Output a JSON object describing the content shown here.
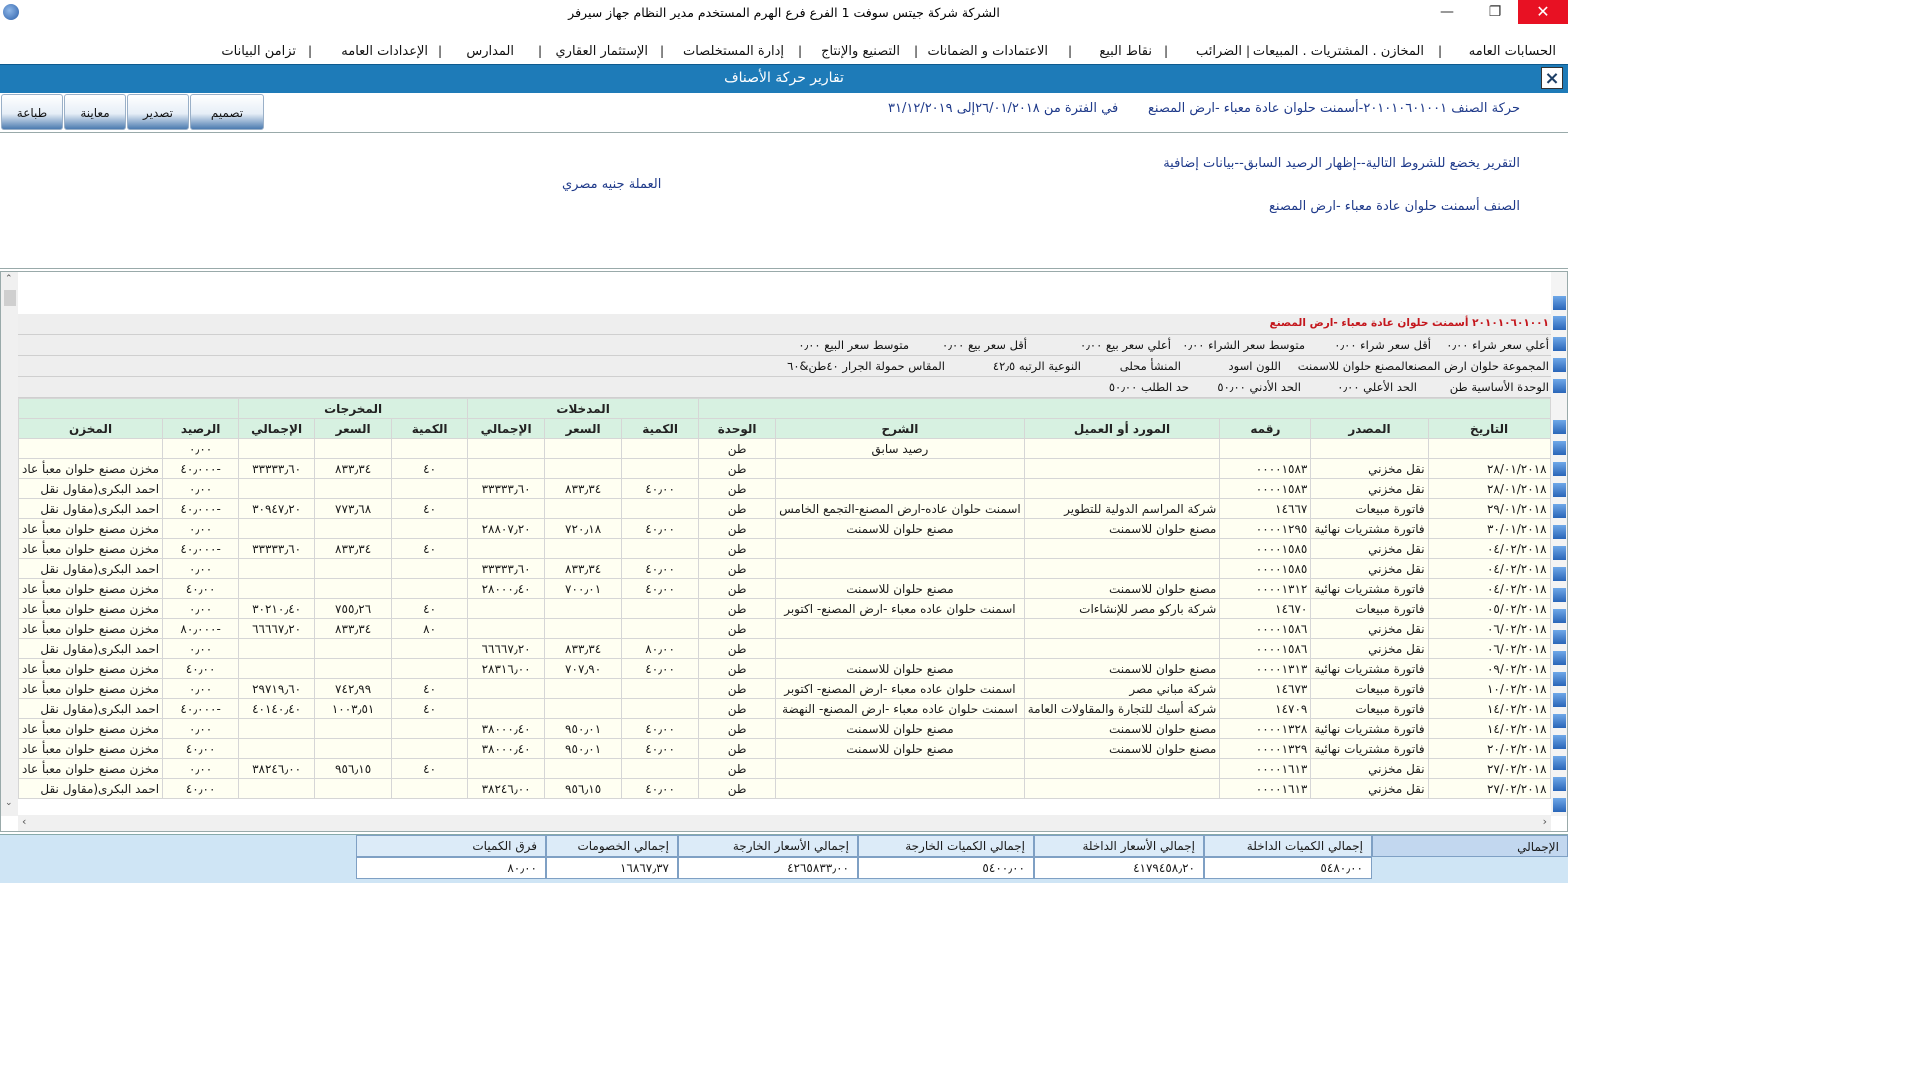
{
  "window": {
    "title": "الشركة شركة جيتس سوفت 1   الفرع فرع الهرم   المستخدم مدير النظام  جهاز سيرفر",
    "minimize_icon": "minimize-icon",
    "maximize_icon": "restore-icon",
    "close_icon": "close-icon"
  },
  "menu": [
    {
      "label": "الحسابات العامه"
    },
    {
      "label": "المخازن . المشتريات . المبيعات"
    },
    {
      "label": "الضرائب"
    },
    {
      "label": "نقاط البيع"
    },
    {
      "label": "الاعتمادات و الضمانات"
    },
    {
      "label": "التصنيع والإنتاج"
    },
    {
      "label": "إدارة المستخلصات"
    },
    {
      "label": "الإستثمار العقاري"
    },
    {
      "label": "المدارس"
    },
    {
      "label": "الإعدادات العامه"
    },
    {
      "label": "تزامن البيانات"
    }
  ],
  "header": {
    "title": "تقارير حركة الأصناف",
    "close": "×"
  },
  "toolbar": {
    "design": "تصميم",
    "export": "تصدير",
    "preview": "معاينة",
    "print": "طباعة"
  },
  "report": {
    "item_title": "حركة الصنف ٢٠١٠١٠٦٠١٠٠١-أسمنت حلوان عادة معباء -ارض المصنع",
    "period": "في الفترة من ٢٦/٠١/٢٠١٨إلى ٣١/١٢/٢٠١٩",
    "conditions": "التقرير يخضع للشروط التالية--إظهار الرصيد السابق--بيانات إضافية",
    "currency": "العملة جنيه مصري",
    "item_line": "الصنف أسمنت حلوان عادة معباء -ارض المصنع"
  },
  "grid_info": {
    "item_code_name": "٢٠١٠١٠٦٠١٠٠١ أسمنت حلوان عادة معباء -ارض المصنع",
    "max_buy": "أعلي سعر شراء ٠٫٠٠",
    "min_buy": "أقل سعر شراء ٠٫٠٠",
    "avg_buy": "متوسط سعر الشراء ٠٫٠٠",
    "max_sell": "أعلي سعر بيع ٠٫٠٠",
    "min_sell": "أقل سعر بيع ٠٫٠٠",
    "avg_sell": "متوسط سعر البيع ٠٫٠٠",
    "group": "المجموعة حلوان ارض المصنعالمصنع حلوان للاسمنت",
    "color": "اللون اسود",
    "origin": "المنشأ محلى",
    "grade": "النوعية الرتبه ٤٢٫٥",
    "size": "المقاس حمولة الجرار ٤٠طن&٦٠",
    "base_unit": "الوحدة الأساسية طن",
    "max_limit": "الحد الأعلي ٠٫٠٠",
    "min_limit": "الحد الأدني ٥٠٫٠٠",
    "reorder": "حد الطلب ٥٠٫٠٠"
  },
  "table": {
    "group_in": "المدخلات",
    "group_out": "المخرجات",
    "columns": {
      "date": "التاريخ",
      "source": "المصدر",
      "number": "رقمه",
      "party": "المورد أو العميل",
      "desc": "الشرح",
      "unit": "الوحدة",
      "in_qty": "الكمية",
      "in_price": "السعر",
      "in_total": "الإجمالي",
      "out_qty": "الكمية",
      "out_price": "السعر",
      "out_total": "الإجمالي",
      "balance": "الرصيد",
      "store": "المخزن"
    },
    "rows": [
      {
        "date": "",
        "source": "",
        "number": "",
        "party": "",
        "desc": "رصيد سابق",
        "unit": "طن",
        "in_qty": "",
        "in_price": "",
        "in_total": "",
        "out_qty": "",
        "out_price": "",
        "out_total": "",
        "balance": "٠٫٠٠",
        "store": ""
      },
      {
        "date": "٢٨/٠١/٢٠١٨",
        "source": "نقل مخزني",
        "number": "٠٠٠٠١٥٨٣",
        "party": "",
        "desc": "",
        "unit": "طن",
        "in_qty": "",
        "in_price": "",
        "in_total": "",
        "out_qty": "٤٠",
        "out_price": "٨٣٣٫٣٤",
        "out_total": "٣٣٣٣٣٫٦٠",
        "balance": "-٤٠٫٠٠٠",
        "store": "مخزن مصنع حلوان معبأ عاد"
      },
      {
        "date": "٢٨/٠١/٢٠١٨",
        "source": "نقل مخزني",
        "number": "٠٠٠٠١٥٨٣",
        "party": "",
        "desc": "",
        "unit": "طن",
        "in_qty": "٤٠٫٠٠",
        "in_price": "٨٣٣٫٣٤",
        "in_total": "٣٣٣٣٣٫٦٠",
        "out_qty": "",
        "out_price": "",
        "out_total": "",
        "balance": "٠٫٠٠",
        "store": "احمد البكرى(مقاول نقل"
      },
      {
        "date": "٢٩/٠١/٢٠١٨",
        "source": "فاتورة مبيعات",
        "number": "١٤٦٦٧",
        "party": "شركة المراسم الدولية للتطوير",
        "desc": "اسمنت حلوان عاده-ارض المصنع-التجمع الخامس",
        "unit": "طن",
        "in_qty": "",
        "in_price": "",
        "in_total": "",
        "out_qty": "٤٠",
        "out_price": "٧٧٣٫٦٨",
        "out_total": "٣٠٩٤٧٫٢٠",
        "balance": "-٤٠٫٠٠٠",
        "store": "احمد البكرى(مقاول نقل"
      },
      {
        "date": "٣٠/٠١/٢٠١٨",
        "source": "فاتورة مشتريات نهائية",
        "number": "٠٠٠٠١٢٩٥",
        "party": "مصنع حلوان للاسمنت",
        "desc": "مصنع حلوان للاسمنت",
        "unit": "طن",
        "in_qty": "٤٠٫٠٠",
        "in_price": "٧٢٠٫١٨",
        "in_total": "٢٨٨٠٧٫٢٠",
        "out_qty": "",
        "out_price": "",
        "out_total": "",
        "balance": "٠٫٠٠",
        "store": "مخزن مصنع حلوان معبأ عاد"
      },
      {
        "date": "٠٤/٠٢/٢٠١٨",
        "source": "نقل مخزني",
        "number": "٠٠٠٠١٥٨٥",
        "party": "",
        "desc": "",
        "unit": "طن",
        "in_qty": "",
        "in_price": "",
        "in_total": "",
        "out_qty": "٤٠",
        "out_price": "٨٣٣٫٣٤",
        "out_total": "٣٣٣٣٣٫٦٠",
        "balance": "-٤٠٫٠٠٠",
        "store": "مخزن مصنع حلوان معبأ عاد"
      },
      {
        "date": "٠٤/٠٢/٢٠١٨",
        "source": "نقل مخزني",
        "number": "٠٠٠٠١٥٨٥",
        "party": "",
        "desc": "",
        "unit": "طن",
        "in_qty": "٤٠٫٠٠",
        "in_price": "٨٣٣٫٣٤",
        "in_total": "٣٣٣٣٣٫٦٠",
        "out_qty": "",
        "out_price": "",
        "out_total": "",
        "balance": "٠٫٠٠",
        "store": "احمد البكرى(مقاول نقل"
      },
      {
        "date": "٠٤/٠٢/٢٠١٨",
        "source": "فاتورة مشتريات نهائية",
        "number": "٠٠٠٠١٣١٢",
        "party": "مصنع حلوان للاسمنت",
        "desc": "مصنع حلوان للاسمنت",
        "unit": "طن",
        "in_qty": "٤٠٫٠٠",
        "in_price": "٧٠٠٫٠١",
        "in_total": "٢٨٠٠٠٫٤٠",
        "out_qty": "",
        "out_price": "",
        "out_total": "",
        "balance": "٤٠٫٠٠",
        "store": "مخزن مصنع حلوان معبأ عاد"
      },
      {
        "date": "٠٥/٠٢/٢٠١٨",
        "source": "فاتورة مبيعات",
        "number": "١٤٦٧٠",
        "party": "شركة باركو مصر للإنشاءات",
        "desc": "اسمنت حلوان عاده معباء -ارض المصنع- اكتوبر",
        "unit": "طن",
        "in_qty": "",
        "in_price": "",
        "in_total": "",
        "out_qty": "٤٠",
        "out_price": "٧٥٥٫٢٦",
        "out_total": "٣٠٢١٠٫٤٠",
        "balance": "٠٫٠٠",
        "store": "مخزن مصنع حلوان معبأ عاد"
      },
      {
        "date": "٠٦/٠٢/٢٠١٨",
        "source": "نقل مخزني",
        "number": "٠٠٠٠١٥٨٦",
        "party": "",
        "desc": "",
        "unit": "طن",
        "in_qty": "",
        "in_price": "",
        "in_total": "",
        "out_qty": "٨٠",
        "out_price": "٨٣٣٫٣٤",
        "out_total": "٦٦٦٦٧٫٢٠",
        "balance": "-٨٠٫٠٠٠",
        "store": "مخزن مصنع حلوان معبأ عاد"
      },
      {
        "date": "٠٦/٠٢/٢٠١٨",
        "source": "نقل مخزني",
        "number": "٠٠٠٠١٥٨٦",
        "party": "",
        "desc": "",
        "unit": "طن",
        "in_qty": "٨٠٫٠٠",
        "in_price": "٨٣٣٫٣٤",
        "in_total": "٦٦٦٦٧٫٢٠",
        "out_qty": "",
        "out_price": "",
        "out_total": "",
        "balance": "٠٫٠٠",
        "store": "احمد البكرى(مقاول نقل"
      },
      {
        "date": "٠٩/٠٢/٢٠١٨",
        "source": "فاتورة مشتريات نهائية",
        "number": "٠٠٠٠١٣١٣",
        "party": "مصنع حلوان للاسمنت",
        "desc": "مصنع حلوان للاسمنت",
        "unit": "طن",
        "in_qty": "٤٠٫٠٠",
        "in_price": "٧٠٧٫٩٠",
        "in_total": "٢٨٣١٦٫٠٠",
        "out_qty": "",
        "out_price": "",
        "out_total": "",
        "balance": "٤٠٫٠٠",
        "store": "مخزن مصنع حلوان معبأ عاد"
      },
      {
        "date": "١٠/٠٢/٢٠١٨",
        "source": "فاتورة مبيعات",
        "number": "١٤٦٧٣",
        "party": "شركة مباني مصر",
        "desc": "اسمنت حلوان عاده معباء -ارض المصنع- اكتوبر",
        "unit": "طن",
        "in_qty": "",
        "in_price": "",
        "in_total": "",
        "out_qty": "٤٠",
        "out_price": "٧٤٢٫٩٩",
        "out_total": "٢٩٧١٩٫٦٠",
        "balance": "٠٫٠٠",
        "store": "مخزن مصنع حلوان معبأ عاد"
      },
      {
        "date": "١٤/٠٢/٢٠١٨",
        "source": "فاتورة مبيعات",
        "number": "١٤٧٠٩",
        "party": "شركة أسيك للتجارة والمقاولات العامة",
        "desc": "اسمنت حلوان عاده معباء -ارض المصنع- النهضة",
        "unit": "طن",
        "in_qty": "",
        "in_price": "",
        "in_total": "",
        "out_qty": "٤٠",
        "out_price": "١٠٠٣٫٥١",
        "out_total": "٤٠١٤٠٫٤٠",
        "balance": "-٤٠٫٠٠٠",
        "store": "احمد البكرى(مقاول نقل"
      },
      {
        "date": "١٤/٠٢/٢٠١٨",
        "source": "فاتورة مشتريات نهائية",
        "number": "٠٠٠٠١٣٢٨",
        "party": "مصنع حلوان للاسمنت",
        "desc": "مصنع حلوان للاسمنت",
        "unit": "طن",
        "in_qty": "٤٠٫٠٠",
        "in_price": "٩٥٠٫٠١",
        "in_total": "٣٨٠٠٠٫٤٠",
        "out_qty": "",
        "out_price": "",
        "out_total": "",
        "balance": "٠٫٠٠",
        "store": "مخزن مصنع حلوان معبأ عاد"
      },
      {
        "date": "٢٠/٠٢/٢٠١٨",
        "source": "فاتورة مشتريات نهائية",
        "number": "٠٠٠٠١٣٢٩",
        "party": "مصنع حلوان للاسمنت",
        "desc": "مصنع حلوان للاسمنت",
        "unit": "طن",
        "in_qty": "٤٠٫٠٠",
        "in_price": "٩٥٠٫٠١",
        "in_total": "٣٨٠٠٠٫٤٠",
        "out_qty": "",
        "out_price": "",
        "out_total": "",
        "balance": "٤٠٫٠٠",
        "store": "مخزن مصنع حلوان معبأ عاد"
      },
      {
        "date": "٢٧/٠٢/٢٠١٨",
        "source": "نقل مخزني",
        "number": "٠٠٠٠١٦١٣",
        "party": "",
        "desc": "",
        "unit": "طن",
        "in_qty": "",
        "in_price": "",
        "in_total": "",
        "out_qty": "٤٠",
        "out_price": "٩٥٦٫١٥",
        "out_total": "٣٨٢٤٦٫٠٠",
        "balance": "٠٫٠٠",
        "store": "مخزن مصنع حلوان معبأ عاد"
      },
      {
        "date": "٢٧/٠٢/٢٠١٨",
        "source": "نقل مخزني",
        "number": "٠٠٠٠١٦١٣",
        "party": "",
        "desc": "",
        "unit": "طن",
        "in_qty": "٤٠٫٠٠",
        "in_price": "٩٥٦٫١٥",
        "in_total": "٣٨٢٤٦٫٠٠",
        "out_qty": "",
        "out_price": "",
        "out_total": "",
        "balance": "٤٠٫٠٠",
        "store": "احمد البكرى(مقاول نقل"
      }
    ]
  },
  "totals": {
    "label": "الإجمالي",
    "in_qty_label": "إجمالي الكميات الداخلة",
    "in_qty": "٥٤٨٠٫٠٠",
    "in_price_label": "إجمالي الأسعار الداخلة",
    "in_price": "٤١٧٩٤٥٨٫٢٠",
    "out_qty_label": "إجمالي الكميات الخارجة",
    "out_qty": "٥٤٠٠٫٠٠",
    "out_price_label": "إجمالي الأسعار الخارجة",
    "out_price": "٤٢٦٥٨٣٣٫٠٠",
    "discount_label": "إجمالي الخصومات",
    "discount": "١٦٨٦٧٫٣٧",
    "diff_label": "فرق الكميات",
    "diff": "٨٠٫٠٠"
  }
}
